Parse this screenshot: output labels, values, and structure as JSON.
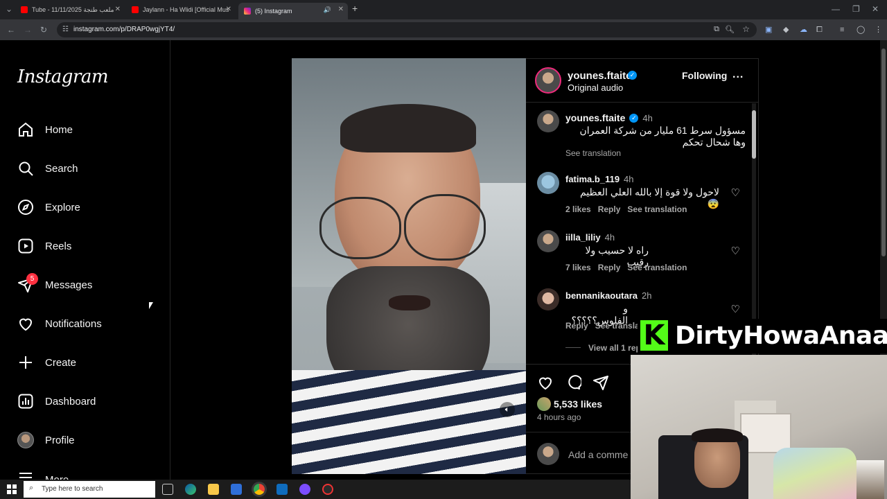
{
  "browser": {
    "tabs": [
      {
        "label": "Tube - 11/11/2025 ملعب طنجة"
      },
      {
        "label": "Jaylann - Ha Wlidi [Official Mus"
      },
      {
        "label": "(5) Instagram"
      }
    ],
    "url": "instagram.com/p/DRAP0wgjYT4/",
    "new_tab": "+"
  },
  "sidebar": {
    "logo": "Instagram",
    "items": [
      {
        "label": "Home",
        "icon": "home-icon"
      },
      {
        "label": "Search",
        "icon": "search-icon"
      },
      {
        "label": "Explore",
        "icon": "compass-icon"
      },
      {
        "label": "Reels",
        "icon": "reels-icon"
      },
      {
        "label": "Messages",
        "icon": "messenger-icon",
        "badge": "5"
      },
      {
        "label": "Notifications",
        "icon": "heart-icon"
      },
      {
        "label": "Create",
        "icon": "plus-icon"
      },
      {
        "label": "Dashboard",
        "icon": "dashboard-icon"
      },
      {
        "label": "Profile",
        "icon": "avatar"
      },
      {
        "label": "More",
        "icon": "menu-icon"
      }
    ]
  },
  "post": {
    "author": "younes.ftaite",
    "subtitle": "Original audio",
    "follow_label": "Following",
    "more": "...",
    "caption": {
      "user": "younes.ftaite",
      "time": "4h",
      "text": "مسؤول سرط 61 مليار من شركة العمران وها شحال تحكم",
      "see_translation": "See translation"
    },
    "comments": [
      {
        "user": "fatima.b_119",
        "time": "4h",
        "text": "لاحول ولا قوة إلا بالله العلي العظيم 😨",
        "likes": "2 likes",
        "reply": "Reply",
        "see_translation": "See translation"
      },
      {
        "user": "iilla_liliy",
        "time": "4h",
        "text": "راه لا حسيب ولا رقيب",
        "likes": "7 likes",
        "reply": "Reply",
        "see_translation": "See translation"
      },
      {
        "user": "bennanikaoutara",
        "time": "2h",
        "text": "و الفلوس؟؟؟؟؟",
        "reply": "Reply",
        "see_translation": "See transla"
      }
    ],
    "view_replies": "View all 1 rep",
    "likes": "5,533 likes",
    "posted": "4 hours ago",
    "add_comment_placeholder": "Add a comme"
  },
  "overlay": {
    "kick_letter": "K",
    "channel": "DirtyHowaAnaa"
  },
  "taskbar": {
    "search_placeholder": "Type here to search"
  }
}
